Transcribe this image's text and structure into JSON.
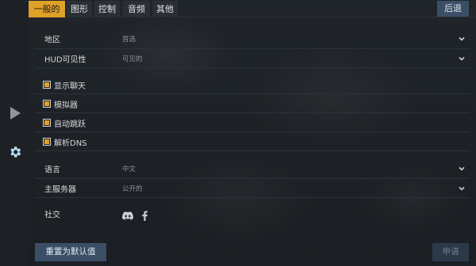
{
  "tabs": [
    {
      "label": "一般的"
    },
    {
      "label": "图形"
    },
    {
      "label": "控制"
    },
    {
      "label": "音频"
    },
    {
      "label": "其他"
    }
  ],
  "back_label": "后退",
  "settings": {
    "region": {
      "label": "地区",
      "value": "首选"
    },
    "hud": {
      "label": "HUD可见性",
      "value": "可见的"
    },
    "language": {
      "label": "语言",
      "value": "中文"
    },
    "server": {
      "label": "主服务器",
      "value": "公开的"
    },
    "social": {
      "label": "社交"
    }
  },
  "checkboxes": [
    {
      "label": "显示聊天",
      "checked": true
    },
    {
      "label": "模拟器",
      "checked": true
    },
    {
      "label": "自动跳跃",
      "checked": true
    },
    {
      "label": "解析DNS",
      "checked": true
    }
  ],
  "buttons": {
    "reset": "重置为默认值",
    "apply": "申请"
  },
  "colors": {
    "accent": "#e0a128",
    "button_blue": "#3a4f66",
    "background": "#1b1f23"
  },
  "icons": {
    "left_top": "play-icon",
    "left_bottom": "gear-icon",
    "social": [
      "discord-icon",
      "facebook-icon"
    ]
  }
}
